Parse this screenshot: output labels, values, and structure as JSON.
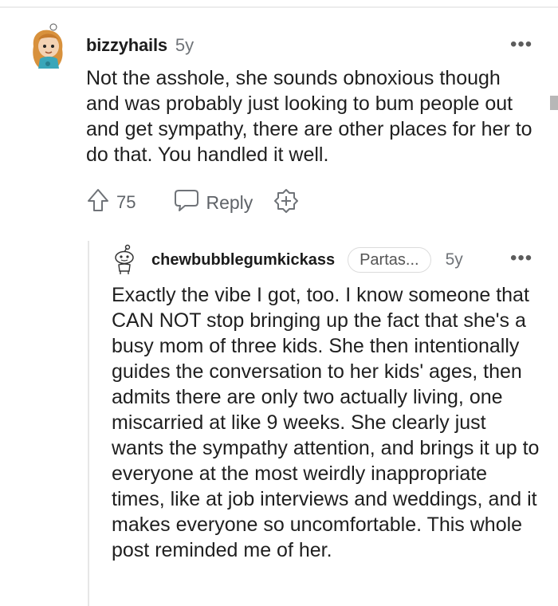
{
  "parent_comment": {
    "username": "bizzyhails",
    "age": "5y",
    "more_icon": "ellipsis-icon",
    "body": "Not the asshole, she sounds obnoxious though and was probably just looking to bum people out and get sympathy, there are other places for her to do that. You handled it well.",
    "score": "75",
    "upvote_icon": "upvote-arrow-icon",
    "reply_icon": "speech-bubble-icon",
    "reply_label": "Reply",
    "award_icon": "award-plus-icon",
    "avatar_icon": "user-avatar-icon"
  },
  "child_comment": {
    "username": "chewbubblegumkickass",
    "flair": "Partas...",
    "age": "5y",
    "more_icon": "ellipsis-icon",
    "avatar_icon": "snoo-avatar-icon",
    "body": "Exactly the vibe I got, too. I know someone that CAN NOT stop bringing up the fact that she's a busy mom of three kids. She then intentionally guides the conversation to her kids' ages, then admits there are only two actually living, one miscarried at like 9 weeks. She clearly just wants the sympathy attention, and brings it up to everyone at the most weirdly inappropriate times, like at job interviews and weddings, and it makes everyone so uncomfortable. This whole post reminded me of her."
  },
  "colors": {
    "text": "#1f1f1f",
    "meta": "#6f7378",
    "divider": "#e6e6e6"
  }
}
